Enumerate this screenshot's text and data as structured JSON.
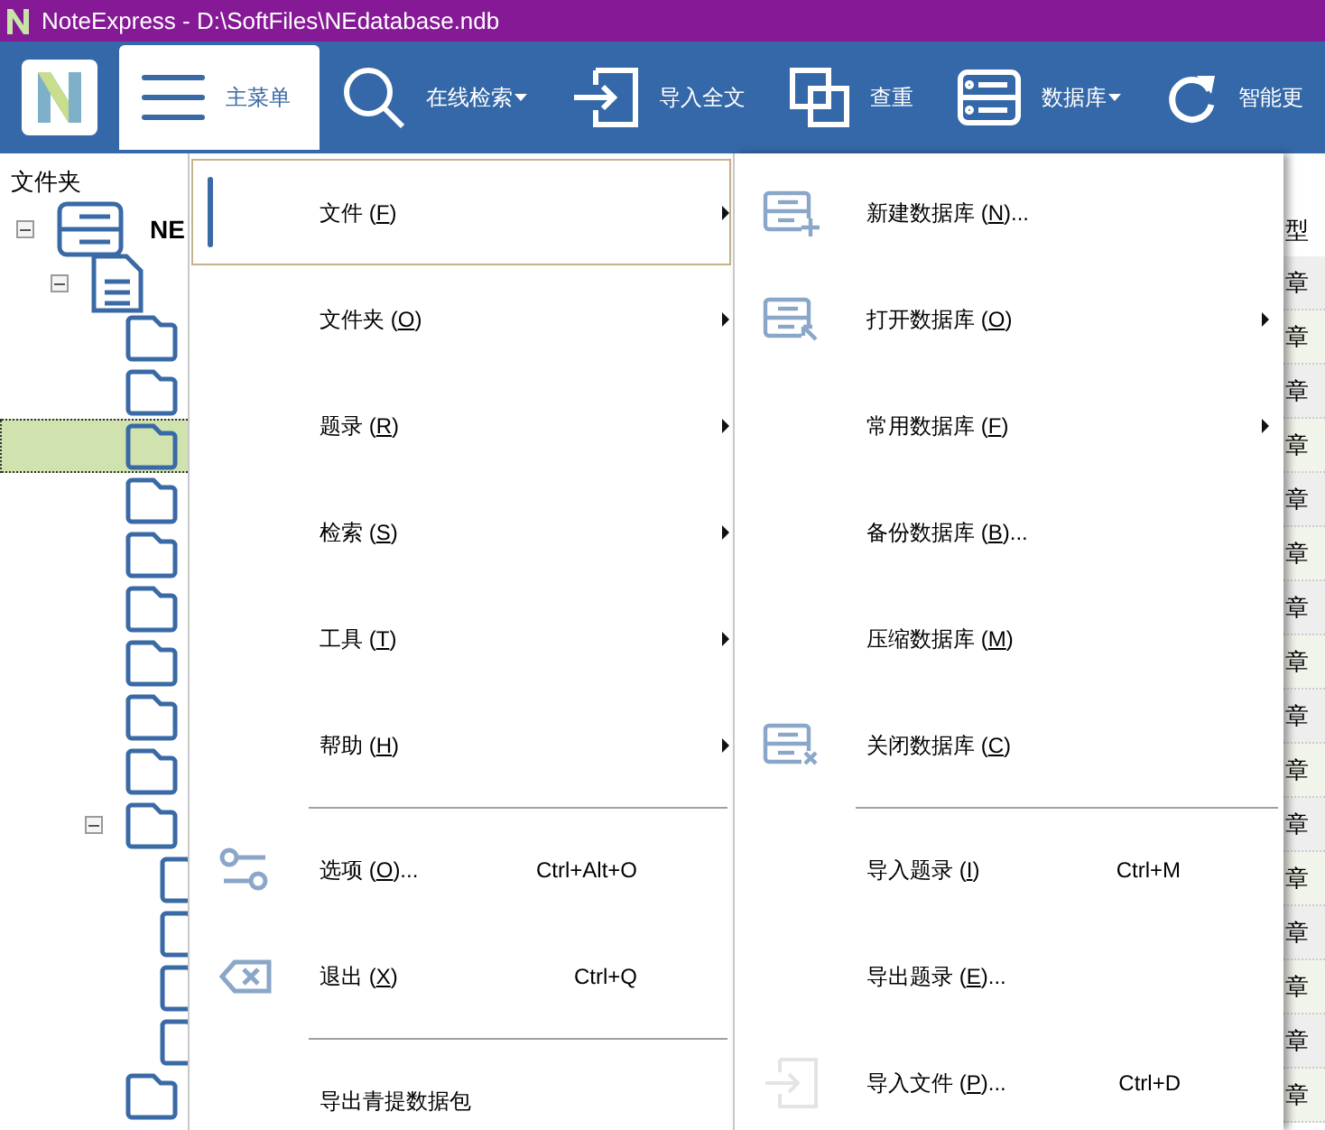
{
  "window": {
    "title": "NoteExpress - D:\\SoftFiles\\NEdatabase.ndb"
  },
  "toolbar": [
    {
      "label": "主菜单",
      "selected": true,
      "dropdown": false
    },
    {
      "label": "在线检索",
      "selected": false,
      "dropdown": true
    },
    {
      "label": "导入全文",
      "selected": false,
      "dropdown": false
    },
    {
      "label": "查重",
      "selected": false,
      "dropdown": false
    },
    {
      "label": "数据库",
      "selected": false,
      "dropdown": true
    },
    {
      "label": "智能更",
      "selected": false,
      "dropdown": false
    }
  ],
  "folder_panel": {
    "title": "文件夹",
    "tree": [
      {
        "kind": "database",
        "label": "NE",
        "expanded": true,
        "selected": false,
        "children": [
          {
            "kind": "document",
            "expanded": true,
            "selected": false,
            "children": [
              {
                "kind": "folder",
                "selected": false
              },
              {
                "kind": "folder",
                "selected": false
              },
              {
                "kind": "folder",
                "selected": true
              },
              {
                "kind": "folder",
                "selected": false
              },
              {
                "kind": "folder",
                "selected": false
              },
              {
                "kind": "folder",
                "selected": false
              },
              {
                "kind": "folder",
                "selected": false
              },
              {
                "kind": "folder",
                "selected": false
              },
              {
                "kind": "folder",
                "selected": false
              },
              {
                "kind": "folder",
                "selected": false,
                "expanded": true,
                "children": [
                  {
                    "kind": "folder",
                    "selected": false
                  },
                  {
                    "kind": "folder",
                    "selected": false
                  },
                  {
                    "kind": "folder",
                    "selected": false
                  },
                  {
                    "kind": "folder",
                    "selected": false
                  }
                ]
              },
              {
                "kind": "folder",
                "selected": false
              }
            ]
          }
        ]
      }
    ]
  },
  "column_1": {
    "header": "型",
    "cells": [
      "章",
      "章",
      "章",
      "章",
      "章",
      "章",
      "章",
      "章",
      "章",
      "章",
      "章",
      "章",
      "章",
      "章",
      "章",
      "章"
    ]
  },
  "main_menu": {
    "items": [
      {
        "kind": "item",
        "label": "文件 (F)",
        "submenu": true,
        "highlighted": true
      },
      {
        "kind": "item",
        "label": "文件夹 (O)",
        "submenu": true,
        "highlighted": false
      },
      {
        "kind": "item",
        "label": "题录 (R)",
        "submenu": true,
        "highlighted": false
      },
      {
        "kind": "item",
        "label": "检索 (S)",
        "submenu": true,
        "highlighted": false
      },
      {
        "kind": "item",
        "label": "工具 (T)",
        "submenu": true,
        "highlighted": false
      },
      {
        "kind": "item",
        "label": "帮助 (H)",
        "submenu": true,
        "highlighted": false
      },
      {
        "kind": "separator"
      },
      {
        "kind": "item",
        "label": "选项 (O)...",
        "shortcut": "Ctrl+Alt+O",
        "submenu": false,
        "highlighted": false
      },
      {
        "kind": "item",
        "label": "退出 (X)",
        "shortcut": "Ctrl+Q",
        "submenu": false,
        "highlighted": false
      },
      {
        "kind": "separator"
      },
      {
        "kind": "item",
        "label": "导出青提数据包",
        "submenu": false,
        "highlighted": false
      }
    ]
  },
  "submenu": {
    "items": [
      {
        "kind": "item",
        "label": "新建数据库 (N)...",
        "submenu": false,
        "highlighted": false
      },
      {
        "kind": "item",
        "label": "打开数据库 (O)",
        "submenu": true,
        "highlighted": false
      },
      {
        "kind": "item",
        "label": "常用数据库 (F)",
        "submenu": true,
        "highlighted": false
      },
      {
        "kind": "item",
        "label": "备份数据库 (B)...",
        "submenu": false,
        "highlighted": false
      },
      {
        "kind": "item",
        "label": "压缩数据库 (M)",
        "submenu": false,
        "highlighted": false
      },
      {
        "kind": "item",
        "label": "关闭数据库 (C)",
        "submenu": false,
        "highlighted": false
      },
      {
        "kind": "separator"
      },
      {
        "kind": "item",
        "label": "导入题录 (I)",
        "shortcut": "Ctrl+M",
        "submenu": false,
        "highlighted": false
      },
      {
        "kind": "item",
        "label": "导出题录 (E)...",
        "submenu": false,
        "highlighted": false
      },
      {
        "kind": "item",
        "label": "导入文件 (P)...",
        "shortcut": "Ctrl+D",
        "submenu": false,
        "highlighted": false
      }
    ]
  }
}
